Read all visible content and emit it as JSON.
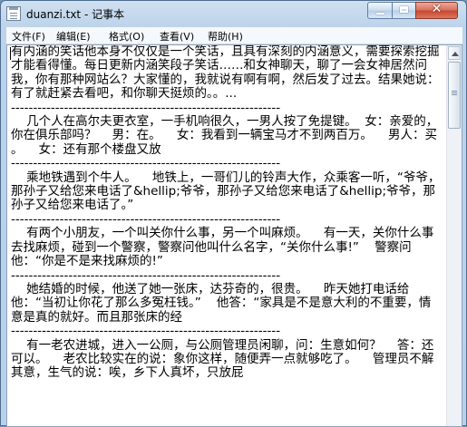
{
  "window": {
    "title": "duanzi.txt - 记事本",
    "close_label": "✕"
  },
  "menu": {
    "items": [
      {
        "label": "文件(F)"
      },
      {
        "label": "编辑(E)"
      },
      {
        "label": "格式(O)"
      },
      {
        "label": "查看(V)"
      },
      {
        "label": "帮助(H)"
      }
    ]
  },
  "document": {
    "content": "有内涵的笑话他本身不仅仅是一个笑话，且具有深刻的内涵意义，需要探索挖掘才能看得懂。每日更新内涵笑段子笑话……和女神聊天，聊了一会女神居然问我，你有那种网站么？大家懂的，我就说有啊有啊，然后发了过去。结果她说：有了就赶紧去看吧，和你聊天挺烦的。。...\n-------------------------------------------------------------\n    几个人在高尔夫更衣室，一手机响很久，一男人按了免提键。  女：亲爱的，你在俱乐部吗？    男：在。    女：我看到一辆宝马才不到两百万。    男人：买 。    女：还有那个楼盘又放\n-------------------------------------------------------------\n    乘地铁遇到个牛人。    地铁上，一哥们儿的铃声大作，众乘客一听，“爷爷，那孙子又给您来电话了&hellip;爷爷，那孙子又给您来电话了&hellip;爷爷，那孙子又给您来电话了。”\n-------------------------------------------------------------\n    有两个小朋友，一个叫关你什么事，另一个叫麻烦。    有一天，关你什么事去找麻烦，碰到一个警察，警察问他叫什么名字，“关你什么事!”    警察问他：“你是不是来找麻烦的!”\n-------------------------------------------------------------\n    她结婚的时候，他送了她一张床，达芬奇的，很贵。    昨天她打电话给他：“当初让你花了那么多冤枉钱。”    他答：“家具是不是意大利的不重要，情意是真的就好。而且那张床的经\n-------------------------------------------------------------\n    有一老农进城，进入一公厕，与公厕管理员闲聊，问：生意如何？    答：还可以。    老农比较实在的说：象你这样，随便弄一点就够吃了。    管理员不解其意，生气的说：唉，乡下人真坏，只放屁"
  }
}
